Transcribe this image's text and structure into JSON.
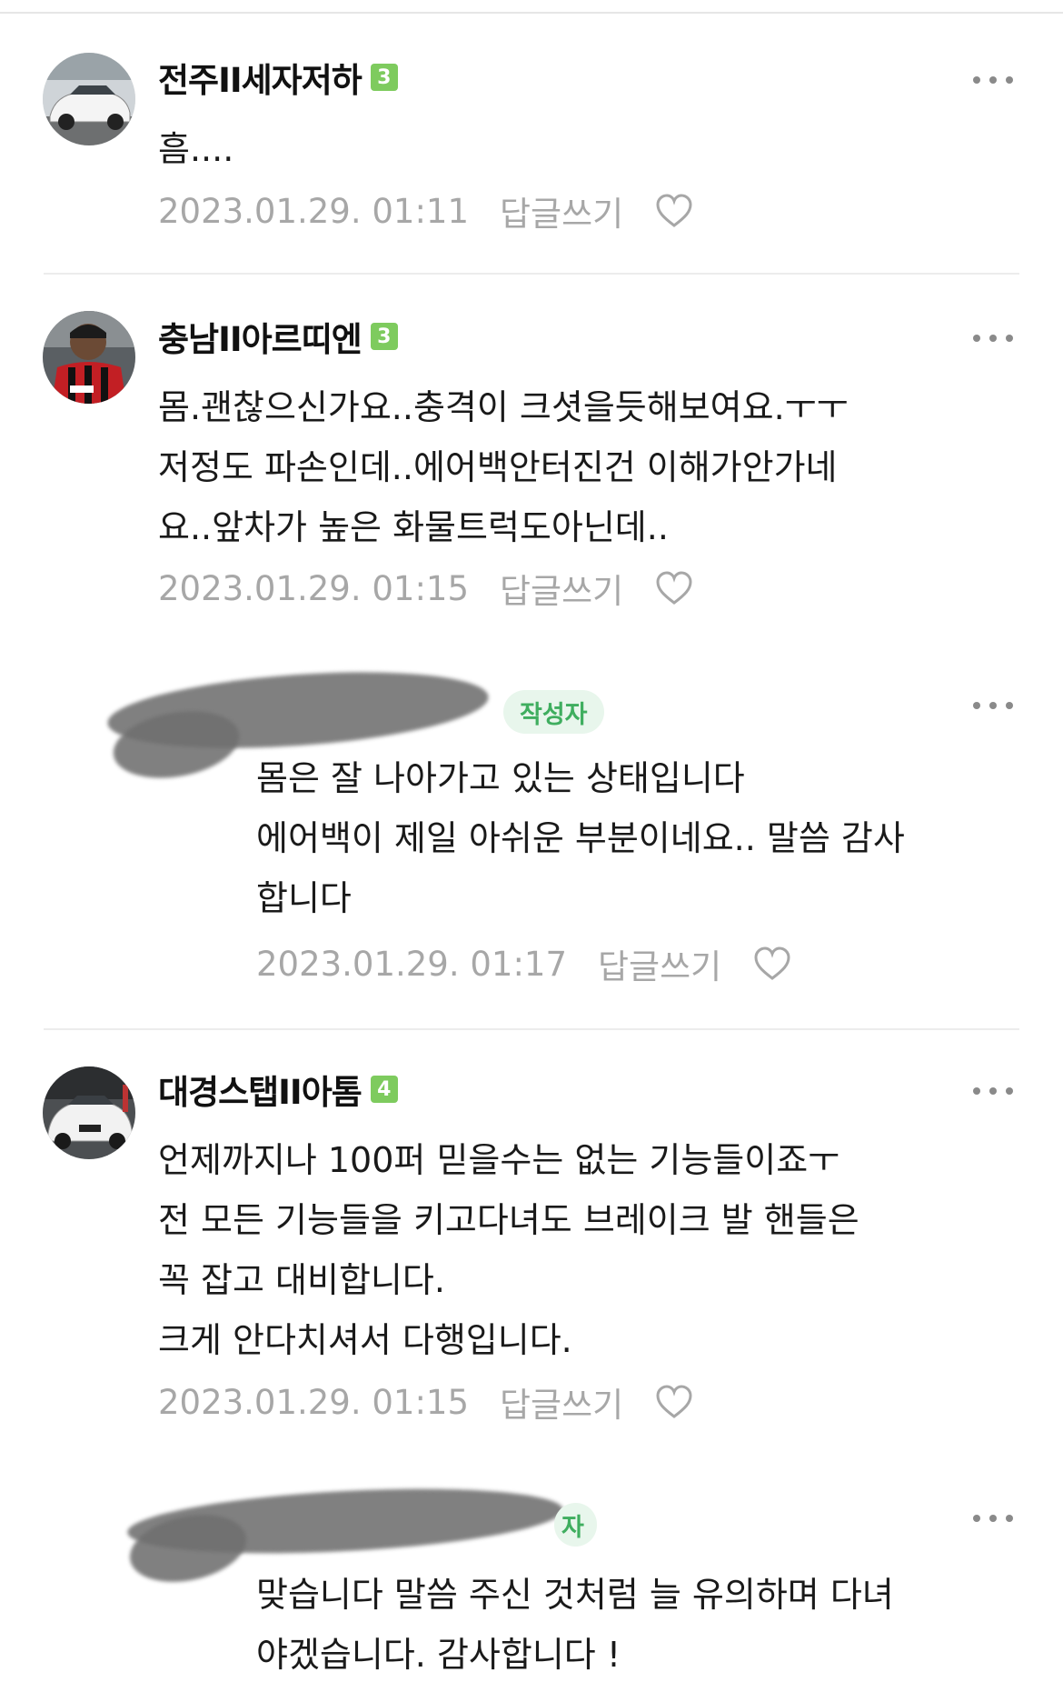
{
  "comments": [
    {
      "nickname": "전주II세자저하",
      "level": "3",
      "text_lines": [
        "흠...."
      ],
      "date": "2023.01.29. 01:11",
      "reply_label": "답글쓰기"
    },
    {
      "nickname": "충남II아르띠엔",
      "level": "3",
      "text_lines": [
        "몸.괜찮으신가요..충격이 크셧을듯해보여요.ㅜㅜ",
        "저정도 파손인데..에어백안터진건 이해가안가네",
        "요..앞차가 높은 화물트럭도아닌데.."
      ],
      "date": "2023.01.29. 01:15",
      "reply_label": "답글쓰기"
    },
    {
      "badge": "작성자",
      "text_lines": [
        "몸은 잘 나아가고 있는 상태입니다",
        "에어백이 제일 아쉬운 부분이네요.. 말씀 감사",
        "합니다"
      ],
      "date": "2023.01.29. 01:17",
      "reply_label": "답글쓰기"
    },
    {
      "nickname": "대경스탭II아톰",
      "level": "4",
      "text_lines": [
        "언제까지나 100퍼 믿을수는 없는 기능들이죠ㅜ",
        "전 모든 기능들을 키고다녀도 브레이크 발 핸들은",
        "꼭 잡고 대비합니다.",
        "크게 안다치셔서 다행입니다."
      ],
      "date": "2023.01.29. 01:15",
      "reply_label": "답글쓰기"
    },
    {
      "badge_partial": "자",
      "text_lines": [
        "맞습니다 말씀 주신 것처럼 늘 유의하며 다녀",
        "야겠습니다. 감사합니다 !"
      ]
    }
  ],
  "icons": {
    "more": "more-dots-icon",
    "heart": "heart-outline-icon"
  },
  "colors": {
    "level_badge": "#7ecb5e",
    "author_badge_bg": "#e8f6ec",
    "author_badge_text": "#3fae5f",
    "meta_text": "#a7a7a7"
  }
}
